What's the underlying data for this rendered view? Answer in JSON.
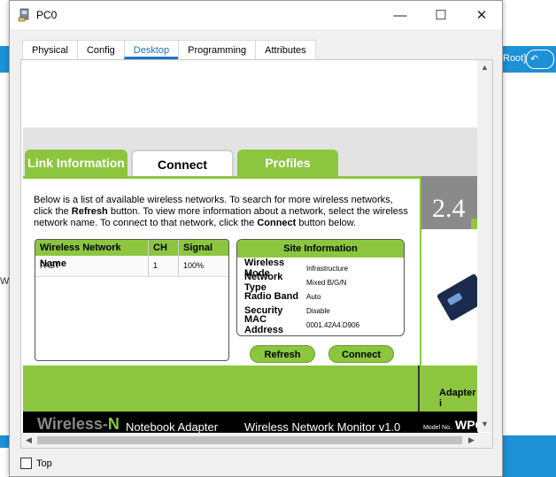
{
  "window": {
    "title": "PC0"
  },
  "background": {
    "right_label": "Root]",
    "left_label": "Wi"
  },
  "tabs": [
    {
      "label": "Physical"
    },
    {
      "label": "Config"
    },
    {
      "label": "Desktop"
    },
    {
      "label": "Programming"
    },
    {
      "label": "Attributes"
    }
  ],
  "app": {
    "tabs": {
      "link": "Link Information",
      "connect": "Connect",
      "profiles": "Profiles"
    },
    "description": {
      "p1": "Below is a list of available wireless networks. To search for more wireless networks, click the ",
      "refresh": "Refresh",
      "p2": " button. To view more information about a network, select the wireless network name. To connect to that network, click the ",
      "connect": "Connect",
      "p3": " button below."
    },
    "table": {
      "headers": {
        "name": "Wireless Network Name",
        "ch": "CH",
        "signal": "Signal"
      },
      "rows": [
        {
          "name": "FAST",
          "ch": "1",
          "signal": "100%"
        }
      ]
    },
    "site_info": {
      "title": "Site Information",
      "rows": [
        {
          "label": "Wireless Mode",
          "value": "Infrastructure"
        },
        {
          "label": "Network Type",
          "value": "Mixed B/G/N"
        },
        {
          "label": "Radio Band",
          "value": "Auto"
        },
        {
          "label": "Security",
          "value": "Disable"
        },
        {
          "label": "MAC Address",
          "value": "0001.42A4.D906"
        }
      ]
    },
    "buttons": {
      "refresh": "Refresh",
      "connect": "Connect"
    },
    "side": {
      "freq": "2.4",
      "adapter": "Adapter i"
    },
    "footer": {
      "brand_a": "Wireless-",
      "brand_b": "N",
      "notebook": "Notebook Adapter",
      "monitor": "Wireless Network Monitor  v1.0",
      "model_label": "Model No.",
      "model": "WPC"
    }
  },
  "bottom": {
    "top_label": "Top"
  }
}
